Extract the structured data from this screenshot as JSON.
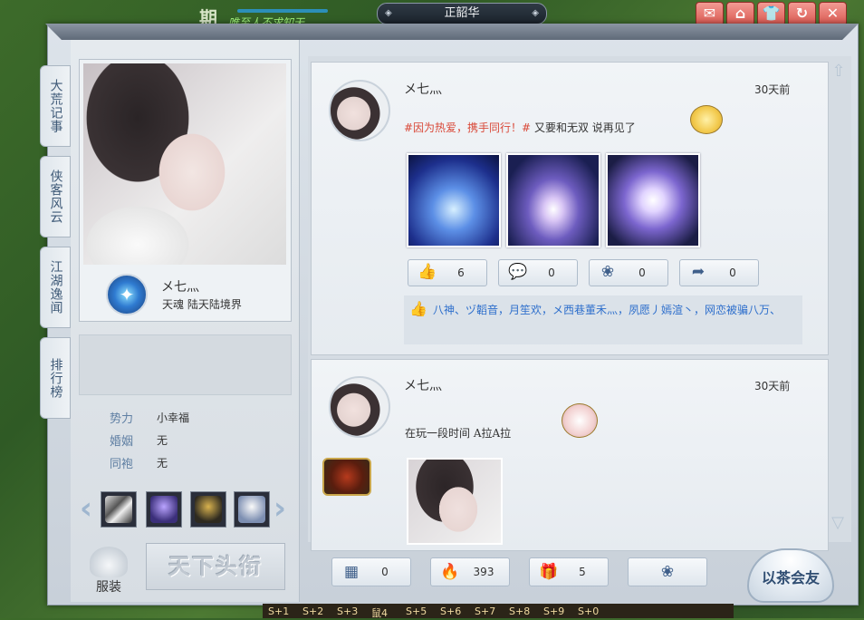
{
  "hud": {
    "title": "期",
    "slogan": "唯至人不求知天",
    "server": "正韶华",
    "buttons": [
      "mail-icon",
      "home-icon",
      "shirt-icon",
      "refresh-icon",
      "close-icon"
    ]
  },
  "tabs": [
    {
      "label": "大荒记事"
    },
    {
      "label": "侠客风云"
    },
    {
      "label": "江湖逸闻"
    },
    {
      "label": "排行榜"
    }
  ],
  "profile": {
    "name": "メ七灬",
    "realm": "天魂 陆天陆境界",
    "info": [
      {
        "label": "势力",
        "value": "小幸福"
      },
      {
        "label": "婚姻",
        "value": "无"
      },
      {
        "label": "同袍",
        "value": "无"
      }
    ],
    "costume_label": "服装",
    "title_button": "天下头衔"
  },
  "posts": [
    {
      "author": "メ七灬",
      "time": "30天前",
      "hashtag": "#因为热爱，携手同行！#",
      "text": " 又要和无双 说再见了",
      "stats": {
        "likes": "6",
        "comments": "0",
        "flowers": "0",
        "shares": "0"
      },
      "liked_by": "八神、ヅ韜音，月笙欢，メ西巷董禾灬，夙愿丿嫣渲丶，网恋被骗八万、"
    },
    {
      "author": "メ七灬",
      "time": "30天前",
      "text": "在玩一段时间   A拉A拉"
    }
  ],
  "bottom": {
    "gifts": "0",
    "popularity": "393",
    "presents": "5",
    "tea_button": "以茶会友"
  },
  "skills": [
    "S+1",
    "S+2",
    "S+3",
    "鼠4",
    "S+5",
    "S+6",
    "S+7",
    "S+8",
    "S+9",
    "S+0"
  ]
}
